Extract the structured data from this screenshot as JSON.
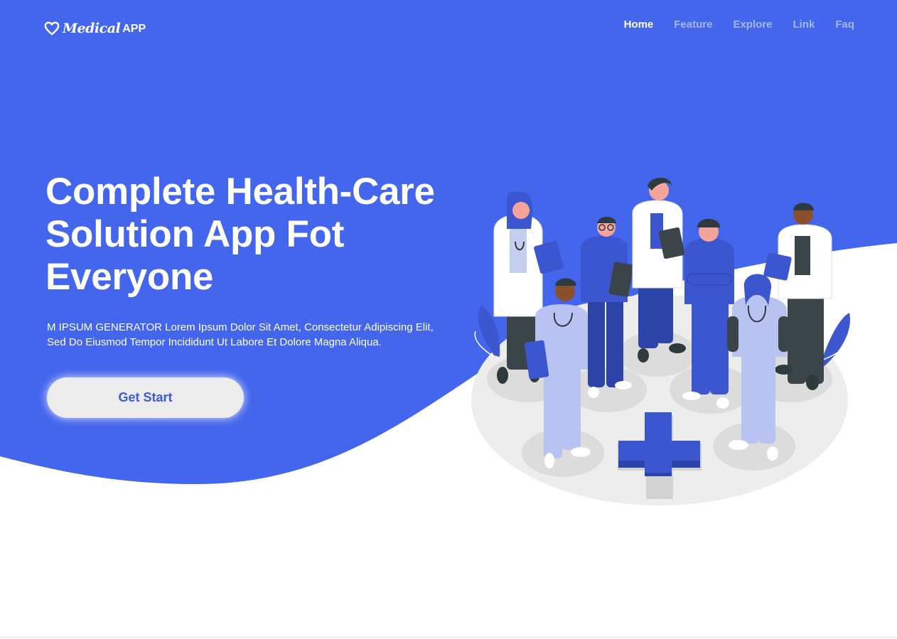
{
  "logo": {
    "brand": "Medical",
    "suffix": "APP",
    "icon": "heart-icon"
  },
  "nav": {
    "items": [
      {
        "label": "Home",
        "active": true
      },
      {
        "label": "Feature",
        "active": false
      },
      {
        "label": "Explore",
        "active": false
      },
      {
        "label": "Link",
        "active": false
      },
      {
        "label": "Faq",
        "active": false
      }
    ]
  },
  "hero": {
    "title": "Complete Health-Care Solution App Fot Everyone",
    "description": "M IPSUM GENERATOR Lorem Ipsum Dolor Sit Amet, Consectetur Adipiscing Elit, Sed Do Eiusmod Tempor Incididunt Ut Labore Et Dolore Magna Aliqua.",
    "cta_label": "Get Start",
    "illustration": "medical-team-illustration"
  },
  "colors": {
    "primary": "#4466ed",
    "nav_inactive": "#a7b6f3",
    "button_bg": "#ececec",
    "button_text": "#3c5ad8",
    "platform": "#ededed",
    "scrub_blue": "#3c56cf",
    "scrub_light": "#b9c3f2"
  }
}
